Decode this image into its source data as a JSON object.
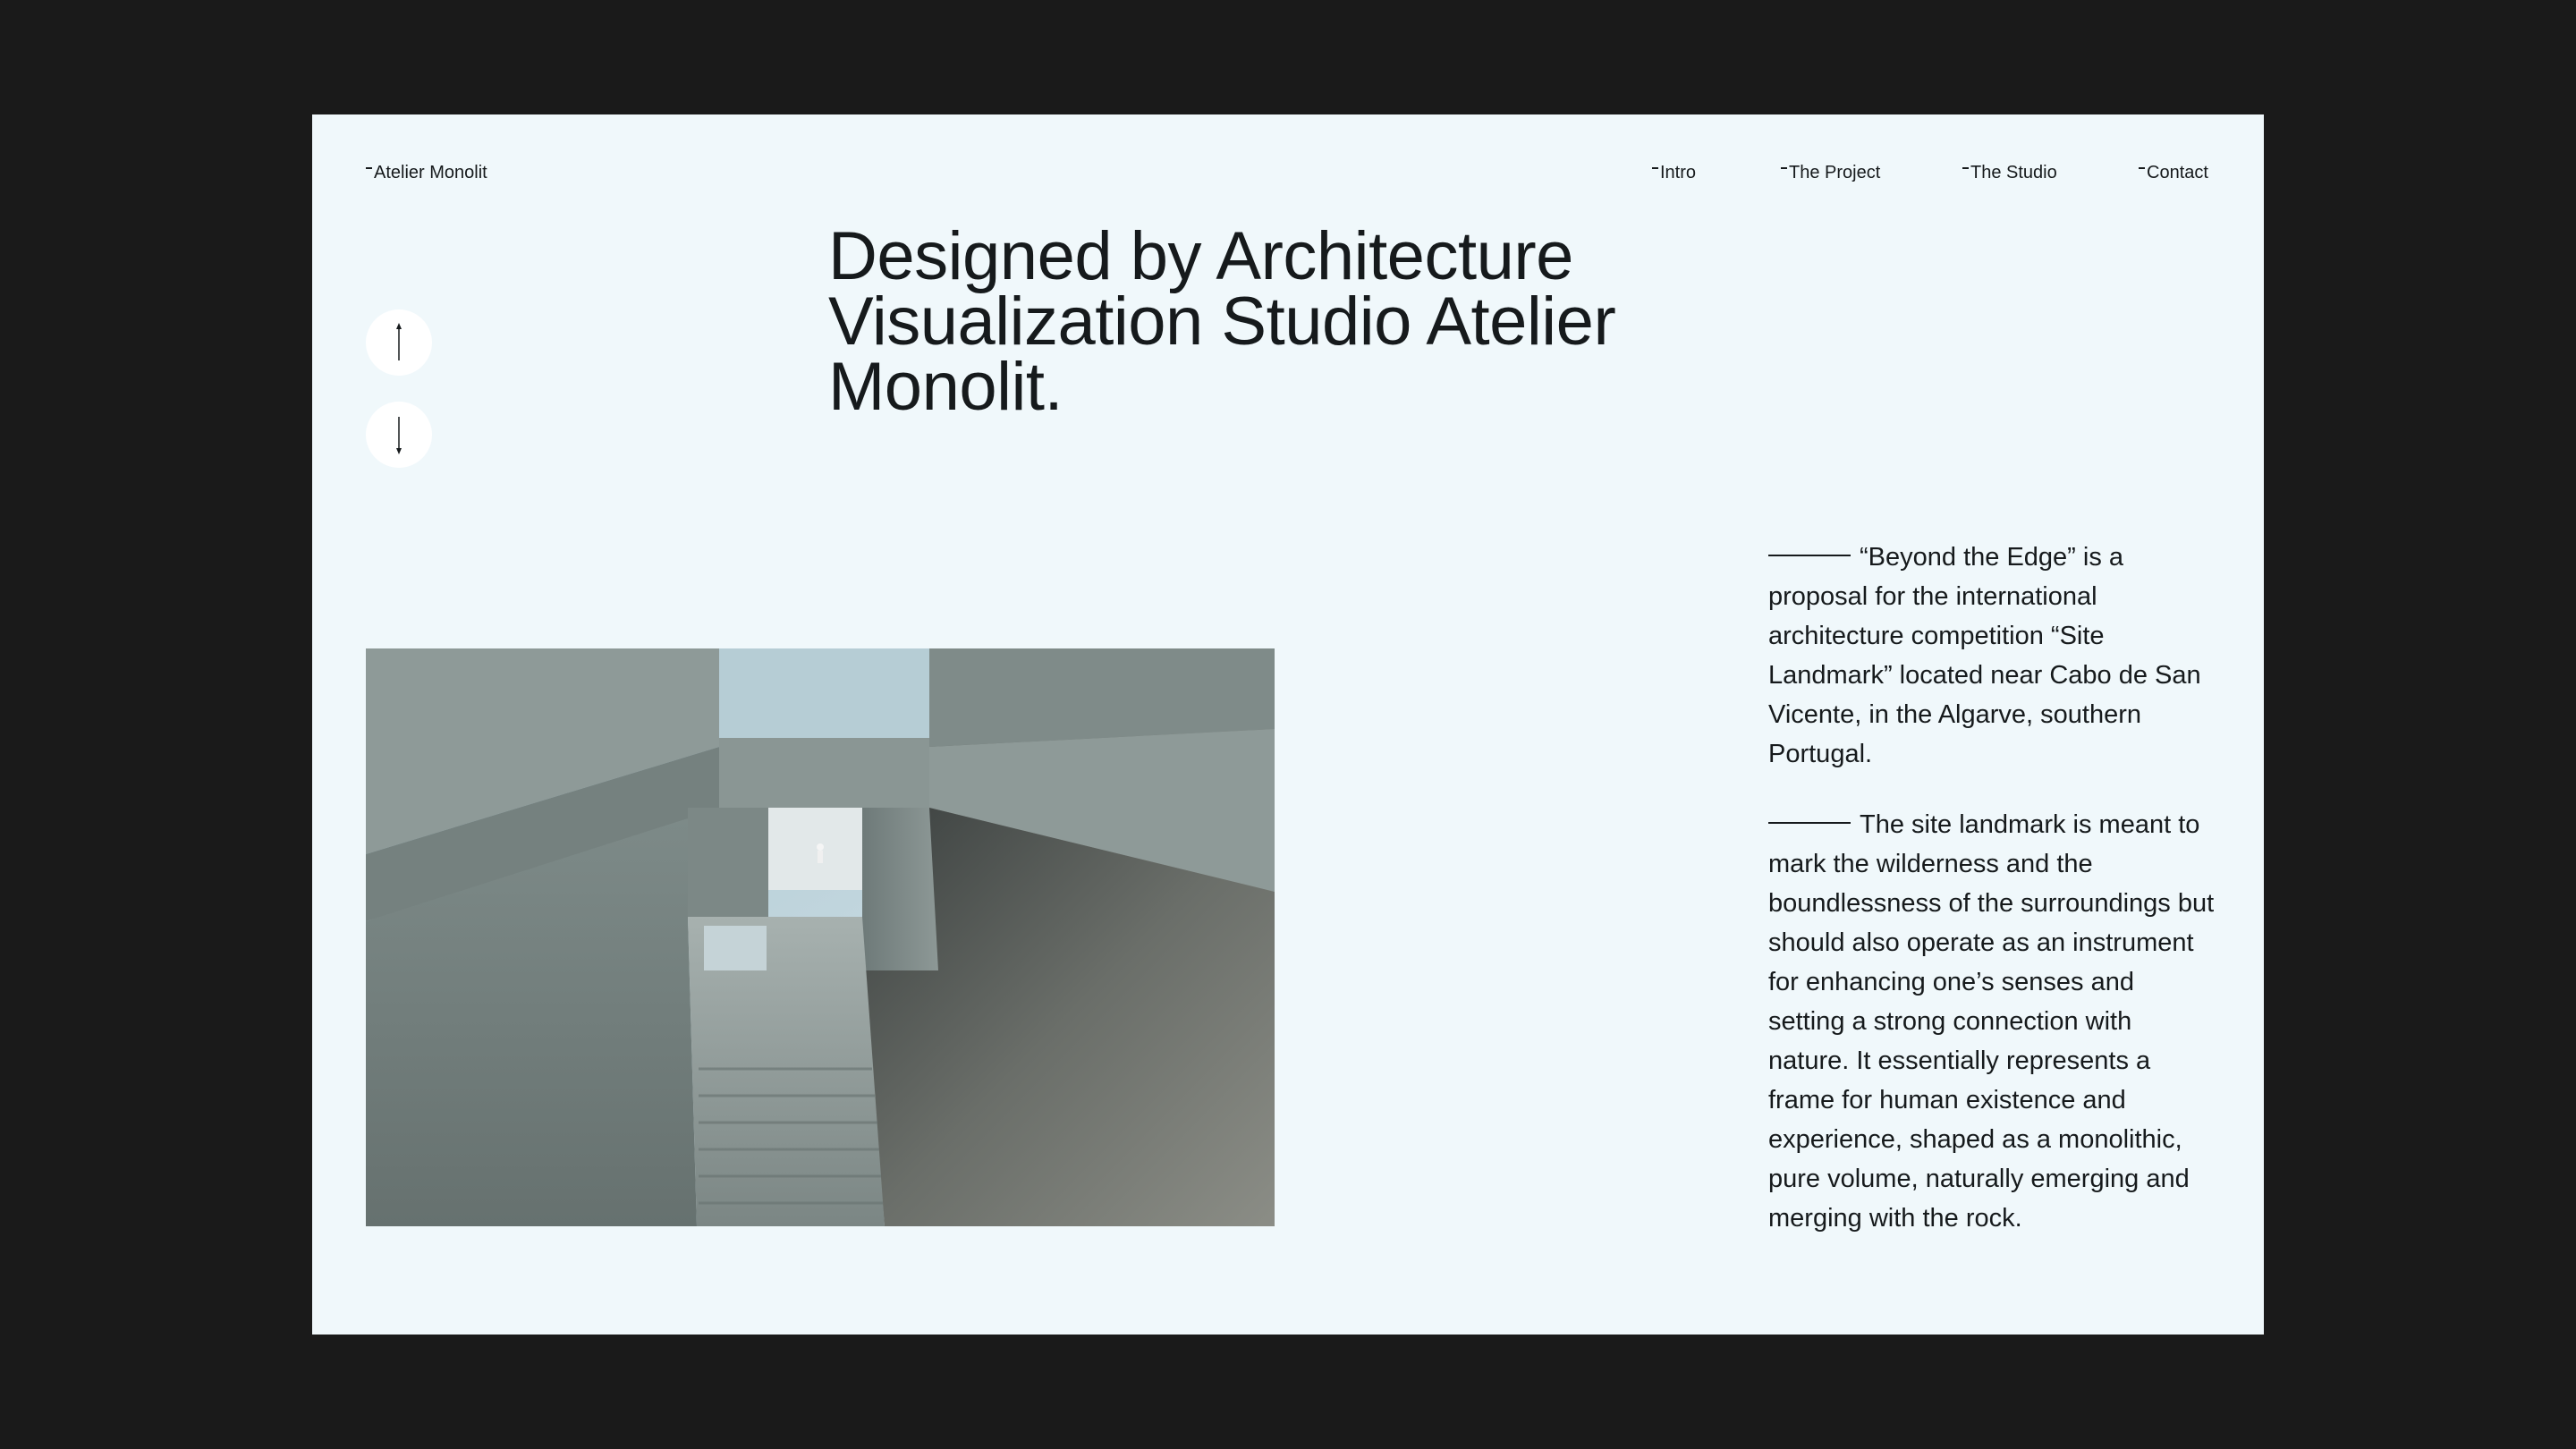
{
  "brand": {
    "name": "Atelier Monolit"
  },
  "nav": {
    "intro": "Intro",
    "project": "The Project",
    "studio": "The Studio",
    "contact": "Contact"
  },
  "hero": {
    "title": "Designed by Architecture Visualization Studio Atelier Monolit."
  },
  "controls": {
    "up_icon": "arrow-up-icon",
    "down_icon": "arrow-down-icon"
  },
  "description": {
    "paragraph_1": "“Beyond the Edge” is a proposal for the international architecture competition “Site Landmark” located near Cabo de San Vicente, in the Algarve, southern Portugal.",
    "paragraph_2": "The site landmark is meant to mark the wilderness and the boundlessness of the surroundings but should also operate as an instrument for enhancing one’s senses and setting a strong connection with nature. It essentially represents a frame for human existence and experience, shaped as a monolithic, pure volume, naturally emerging and merging with the rock."
  },
  "colors": {
    "page_background": "#f0f8fb",
    "outer_background": "#1a1a1a",
    "text": "#161a1c"
  }
}
